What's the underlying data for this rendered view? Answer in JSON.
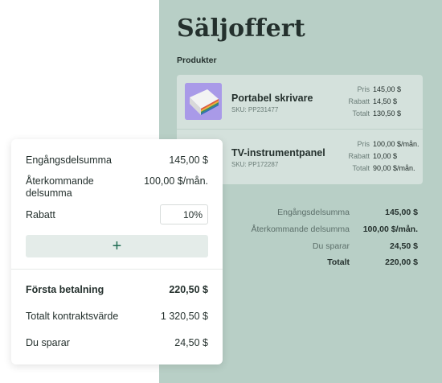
{
  "quote": {
    "title": "Säljoffert",
    "section_label": "Produkter",
    "products": [
      {
        "name": "Portabel skrivare",
        "sku": "SKU: PP231477",
        "details": [
          {
            "label": "Pris",
            "value": "145,00 $"
          },
          {
            "label": "Rabatt",
            "value": "14,50 $"
          },
          {
            "label": "Totalt",
            "value": "130,50 $"
          }
        ]
      },
      {
        "name": "TV-instrumentpanel",
        "sku": "SKU: PP172287",
        "details": [
          {
            "label": "Pris",
            "value": "100,00 $/mån."
          },
          {
            "label": "Rabatt",
            "value": "10,00 $"
          },
          {
            "label": "Totalt",
            "value": "90,00 $/mån."
          }
        ]
      }
    ],
    "summary": [
      {
        "label": "Engångsdelsumma",
        "value": "145,00 $"
      },
      {
        "label": "Återkommande delsumma",
        "value": "100,00 $/mån."
      },
      {
        "label": "Du sparar",
        "value": "24,50 $"
      },
      {
        "label": "Totalt",
        "value": "220,00 $"
      }
    ]
  },
  "card": {
    "one_time_subtotal": {
      "label": "Engångsdelsumma",
      "value": "145,00 $"
    },
    "recurring_subtotal": {
      "label_line1": "Återkommande",
      "label_line2": "delsumma",
      "value": "100,00 $/mån."
    },
    "discount": {
      "label": "Rabatt",
      "value": "10%"
    },
    "add_button_icon": "plus-icon",
    "add_button_symbol": "+",
    "first_payment": {
      "label": "Första betalning",
      "value": "220,50 $"
    },
    "total_contract_value": {
      "label": "Totalt kontraktsvärde",
      "value": "1 320,50 $"
    },
    "you_save": {
      "label": "Du sparar",
      "value": "24,50 $"
    }
  },
  "colors": {
    "panel_bg": "#b8cfc6",
    "products_bg": "#d4e1dc",
    "accent": "#1e6b52"
  }
}
